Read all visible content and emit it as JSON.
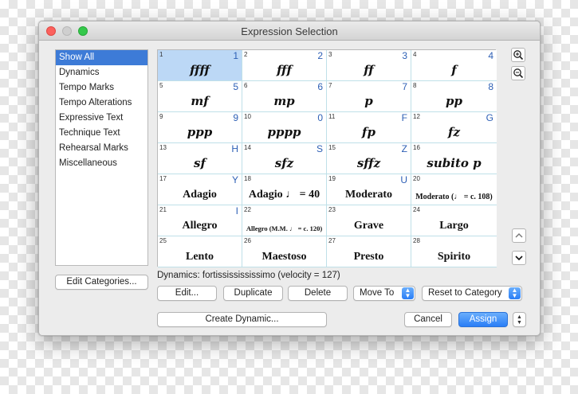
{
  "window": {
    "title": "Expression Selection"
  },
  "categories": [
    "Show All",
    "Dynamics",
    "Tempo Marks",
    "Tempo Alterations",
    "Expressive Text",
    "Technique Text",
    "Rehearsal Marks",
    "Miscellaneous"
  ],
  "selected_category": "Show All",
  "edit_categories_label": "Edit Categories...",
  "grid": [
    {
      "n": "1",
      "key": "1",
      "label": "ffff",
      "kind": "dyn",
      "selected": true
    },
    {
      "n": "2",
      "key": "2",
      "label": "fff",
      "kind": "dyn"
    },
    {
      "n": "3",
      "key": "3",
      "label": "ff",
      "kind": "dyn"
    },
    {
      "n": "4",
      "key": "4",
      "label": "f",
      "kind": "dyn"
    },
    {
      "n": "5",
      "key": "5",
      "label": "mf",
      "kind": "dyn"
    },
    {
      "n": "6",
      "key": "6",
      "label": "mp",
      "kind": "dyn"
    },
    {
      "n": "7",
      "key": "7",
      "label": "p",
      "kind": "dyn"
    },
    {
      "n": "8",
      "key": "8",
      "label": "pp",
      "kind": "dyn"
    },
    {
      "n": "9",
      "key": "9",
      "label": "ppp",
      "kind": "dyn"
    },
    {
      "n": "10",
      "key": "0",
      "label": "pppp",
      "kind": "dyn"
    },
    {
      "n": "11",
      "key": "F",
      "label": "fp",
      "kind": "dyn"
    },
    {
      "n": "12",
      "key": "G",
      "label": "fz",
      "kind": "dyn"
    },
    {
      "n": "13",
      "key": "H",
      "label": "sf",
      "kind": "dyn"
    },
    {
      "n": "14",
      "key": "S",
      "label": "sfz",
      "kind": "dyn"
    },
    {
      "n": "15",
      "key": "Z",
      "label": "sffz",
      "kind": "dyn"
    },
    {
      "n": "16",
      "key": "",
      "label": "subito p",
      "kind": "subito"
    },
    {
      "n": "17",
      "key": "Y",
      "label": "Adagio",
      "kind": "tempo"
    },
    {
      "n": "18",
      "key": "",
      "label": "Adagio ♩ = 40",
      "kind": "tempo"
    },
    {
      "n": "19",
      "key": "U",
      "label": "Moderato",
      "kind": "tempo"
    },
    {
      "n": "20",
      "key": "",
      "label": "Moderato  (♩ = c. 108)",
      "kind": "tempo-small"
    },
    {
      "n": "21",
      "key": "I",
      "label": "Allegro",
      "kind": "tempo"
    },
    {
      "n": "22",
      "key": "",
      "label": "Allegro  (M.M. ♩ = c. 120)",
      "kind": "tempo-tiny"
    },
    {
      "n": "23",
      "key": "",
      "label": "Grave",
      "kind": "tempo"
    },
    {
      "n": "24",
      "key": "",
      "label": "Largo",
      "kind": "tempo"
    },
    {
      "n": "25",
      "key": "",
      "label": "Lento",
      "kind": "tempo"
    },
    {
      "n": "26",
      "key": "",
      "label": "Maestoso",
      "kind": "tempo"
    },
    {
      "n": "27",
      "key": "",
      "label": "Presto",
      "kind": "tempo"
    },
    {
      "n": "28",
      "key": "",
      "label": "Spirito",
      "kind": "tempo"
    }
  ],
  "status": "Dynamics: fortississississimo (velocity = 127)",
  "buttons": {
    "edit": "Edit...",
    "duplicate": "Duplicate",
    "delete": "Delete",
    "move_to": "Move To",
    "reset_to_category": "Reset to Category",
    "create_dynamic": "Create Dynamic...",
    "cancel": "Cancel",
    "assign": "Assign"
  },
  "icons": {
    "zoom_in": "zoom-in-icon",
    "zoom_out": "zoom-out-icon",
    "scroll_up": "chevron-up-icon",
    "scroll_down": "chevron-down-icon"
  },
  "colors": {
    "accent": "#3d7bd7",
    "grid_line": "#bfe0e8",
    "shortcut_key": "#2d5fb5"
  }
}
